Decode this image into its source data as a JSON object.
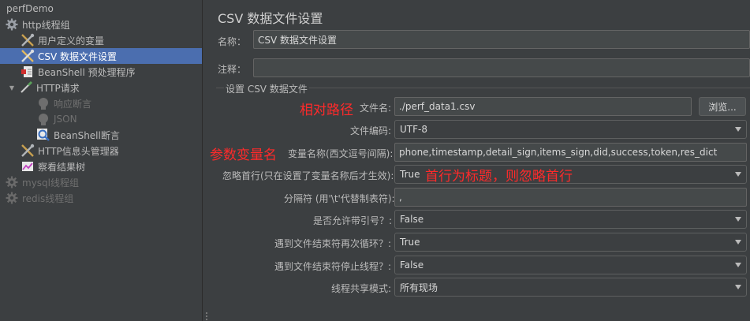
{
  "tree": {
    "items": [
      {
        "label": "perfDemo",
        "icon": "none"
      },
      {
        "label": "http线程组",
        "icon": "gear-icon"
      },
      {
        "label": "用户定义的变量",
        "icon": "tools-icon"
      },
      {
        "label": "CSV 数据文件设置",
        "icon": "tools-icon"
      },
      {
        "label": "BeanShell 预处理程序",
        "icon": "preprocessor-icon"
      },
      {
        "label": "HTTP请求",
        "icon": "pipette-icon"
      },
      {
        "label": "响应断言",
        "icon": "assertion-icon"
      },
      {
        "label": "JSON",
        "icon": "assertion-icon"
      },
      {
        "label": "BeanShell断言",
        "icon": "magnifier-icon"
      },
      {
        "label": "HTTP信息头管理器",
        "icon": "tools-icon"
      },
      {
        "label": "察看结果树",
        "icon": "chart-icon"
      },
      {
        "label": "mysql线程组",
        "icon": "gear-icon"
      },
      {
        "label": "redis线程组",
        "icon": "gear-icon"
      }
    ]
  },
  "panel": {
    "title": "CSV 数据文件设置",
    "name_label": "名称：",
    "name_value": "CSV 数据文件设置",
    "comment_label": "注释：",
    "comment_value": "",
    "group_title": "设置 CSV 数据文件",
    "filename_label": "文件名:",
    "filename_value": "./perf_data1.csv",
    "browse_button": "浏览...",
    "encoding_label": "文件编码:",
    "encoding_value": "UTF-8",
    "varnames_label": "变量名称(西文逗号间隔):",
    "varnames_value": "phone,timestamp,detail_sign,items_sign,did,success,token,res_dict",
    "ignore_first_label": "忽略首行(只在设置了变量名称后才生效):",
    "ignore_first_value": "True",
    "delimiter_label": "分隔符 (用'\\t'代替制表符):",
    "delimiter_value": ",",
    "quoted_label": "是否允许带引号？:",
    "quoted_value": "False",
    "recycle_label": "遇到文件结束符再次循环？:",
    "recycle_value": "True",
    "stop_label": "遇到文件结束符停止线程？:",
    "stop_value": "False",
    "sharing_label": "线程共享模式:",
    "sharing_value": "所有现场"
  },
  "annotations": {
    "relative_path": "相对路径",
    "param_vars": "参数变量名",
    "first_row": "首行为标题，则忽略首行"
  },
  "colors": {
    "selection": "#4b6eaf",
    "annotation": "#ff2a2a",
    "background": "#3c3f41"
  }
}
